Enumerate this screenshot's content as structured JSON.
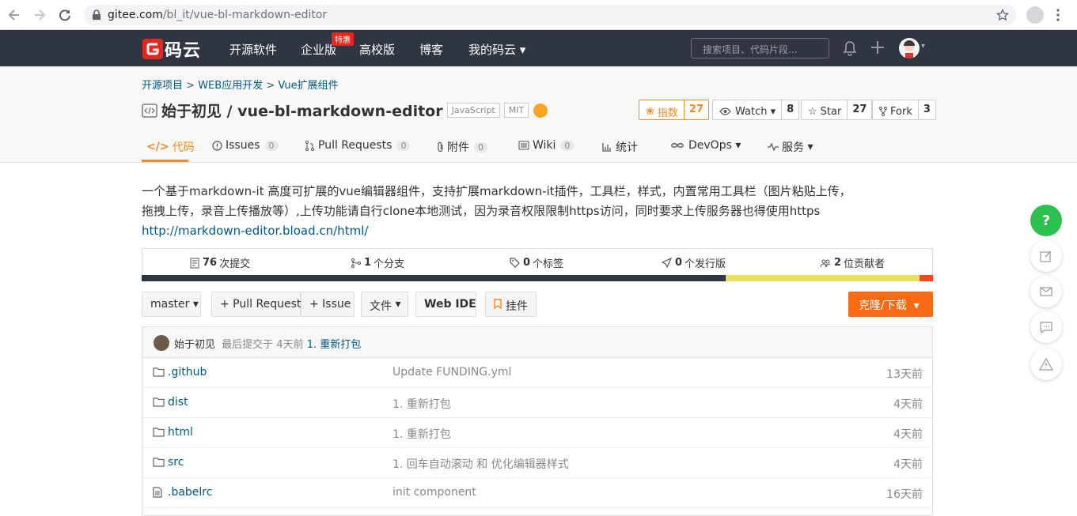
{
  "browser": {
    "url_host": "gitee.com",
    "url_path": "/bl_it/vue-bl-markdown-editor"
  },
  "header": {
    "logo_text": "码云",
    "nav": [
      "开源软件",
      "企业版",
      "高校版",
      "博客",
      "我的码云"
    ],
    "badge": "特惠",
    "search_placeholder": "搜索项目、代码片段..."
  },
  "project": {
    "breadcrumb": [
      "开源项目",
      "WEB应用开发",
      "Vue扩展组件"
    ],
    "breadcrumb_sep": ">",
    "title": "始于初见 / vue-bl-markdown-editor",
    "tags": [
      "JavaScript",
      "MIT"
    ],
    "buttons": {
      "index_label": "指数",
      "index_count": "27",
      "watch_label": "Watch",
      "watch_count": "8",
      "star_label": "Star",
      "star_count": "27",
      "fork_label": "Fork",
      "fork_count": "3"
    },
    "tabs": [
      {
        "label": "代码"
      },
      {
        "label": "Issues",
        "count": "0"
      },
      {
        "label": "Pull Requests",
        "count": "0"
      },
      {
        "label": "附件",
        "count": "0"
      },
      {
        "label": "Wiki",
        "count": "0"
      },
      {
        "label": "统计"
      },
      {
        "label": "DevOps"
      },
      {
        "label": "服务"
      }
    ]
  },
  "description": {
    "line1": "一个基于markdown-it 高度可扩展的vue编辑器组件，支持扩展markdown-it插件，工具栏，样式，内置常用工具栏（图片粘贴上传，",
    "line2": "拖拽上传，录音上传播放等）,上传功能请自行clone本地测试，因为录音权限限制https访问，同时要求上传服务器也得使用https",
    "link": "http://markdown-editor.bload.cn/html/"
  },
  "stats": [
    {
      "num": "76",
      "label": "次提交"
    },
    {
      "num": "1",
      "label": "个分支"
    },
    {
      "num": "0",
      "label": "个标签"
    },
    {
      "num": "0",
      "label": "个发行版"
    },
    {
      "num": "2",
      "label": "位贡献者"
    }
  ],
  "languages": [
    {
      "share": 0.738,
      "color": "#2f3541"
    },
    {
      "share": 0.245,
      "color": "#e8e05b"
    },
    {
      "share": 0.017,
      "color": "#f34b1d"
    }
  ],
  "toolbar": {
    "branch": "master",
    "pull_request": "+ Pull Request",
    "issue": "+ Issue",
    "files": "文件",
    "web_ide": "Web IDE",
    "pendant": "挂件",
    "clone": "克隆/下载"
  },
  "last_commit": {
    "author": "始于初见",
    "text": "最后提交于",
    "time": "4天前",
    "message": "1. 重新打包"
  },
  "files": [
    {
      "type": "folder",
      "name": ".github",
      "message": "Update FUNDING.yml",
      "time": "13天前"
    },
    {
      "type": "folder",
      "name": "dist",
      "message": "1. 重新打包",
      "time": "4天前"
    },
    {
      "type": "folder",
      "name": "html",
      "message": "1. 重新打包",
      "time": "4天前"
    },
    {
      "type": "folder",
      "name": "src",
      "message": "1. 回车自动滚动 和 优化编辑器样式",
      "time": "4天前"
    },
    {
      "type": "file",
      "name": ".babelrc",
      "message": "init component",
      "time": "16天前"
    }
  ],
  "side": {
    "help": "?"
  }
}
